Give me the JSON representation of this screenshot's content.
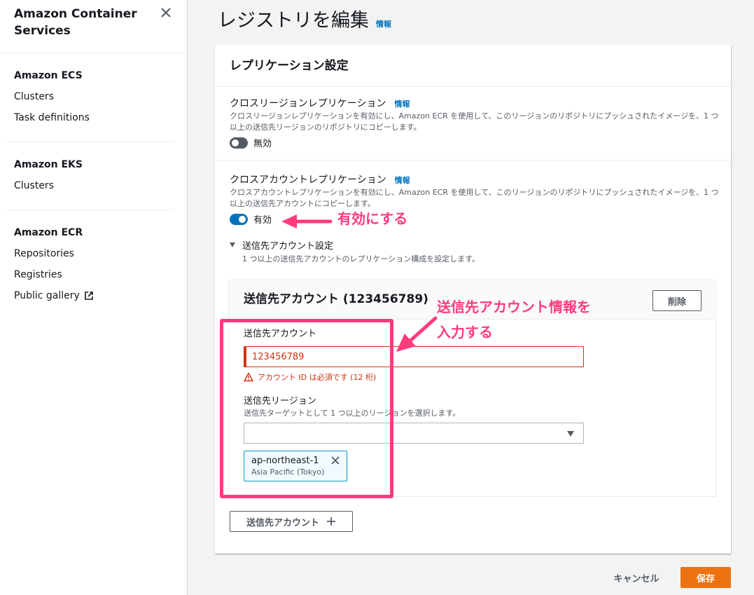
{
  "sidebar": {
    "title": "Amazon Container Services",
    "sections": [
      {
        "title": "Amazon ECS",
        "items": [
          "Clusters",
          "Task definitions"
        ]
      },
      {
        "title": "Amazon EKS",
        "items": [
          "Clusters"
        ]
      },
      {
        "title": "Amazon ECR",
        "items": [
          "Repositories",
          "Registries",
          "Public gallery"
        ]
      }
    ]
  },
  "page": {
    "title": "レジストリを編集",
    "info": "情報"
  },
  "panel": {
    "title": "レプリケーション設定",
    "cross_region": {
      "title": "クロスリージョンレプリケーション",
      "info": "情報",
      "desc": "クロスリージョンレプリケーションを有効にし、Amazon ECR を使用して、このリージョンのリポジトリにプッシュされたイメージを、1 つ以上の送信先リージョンのリポジトリにコピーします。",
      "toggle_label": "無効",
      "enabled": false
    },
    "cross_account": {
      "title": "クロスアカウントレプリケーション",
      "info": "情報",
      "desc": "クロスアカウントレプリケーションを有効にし、Amazon ECR を使用して、このリージョンのリポジトリにプッシュされたイメージを、1 つ以上の送信先アカウントにコピーします。",
      "toggle_label": "有効",
      "enabled": true
    },
    "dest_settings": {
      "title": "送信先アカウント設定",
      "desc": "1 つ以上の送信先アカウントのレプリケーション構成を設定します。"
    },
    "dest_account": {
      "title": "送信先アカウント (123456789)",
      "delete_label": "削除",
      "account_label": "送信先アカウント",
      "account_value": "123456789",
      "account_error": "アカウント ID は必須です (12 桁)",
      "region_label": "送信先リージョン",
      "region_desc": "送信先ターゲットとして 1 つ以上のリージョンを選択します。",
      "region_token": {
        "title": "ap-northeast-1",
        "sub": "Asia Pacific (Tokyo)"
      }
    },
    "add_label": "送信先アカウント"
  },
  "footer": {
    "cancel_label": "キャンセル",
    "save_label": "保存"
  },
  "annotations": {
    "enable": "有効にする",
    "input_line1": "送信先アカウント情報を",
    "input_line2": "入力する"
  },
  "colors": {
    "accent": "#0073bb",
    "error": "#d13212",
    "primary_button": "#ec7211",
    "annotation": "#ff3b7f"
  }
}
